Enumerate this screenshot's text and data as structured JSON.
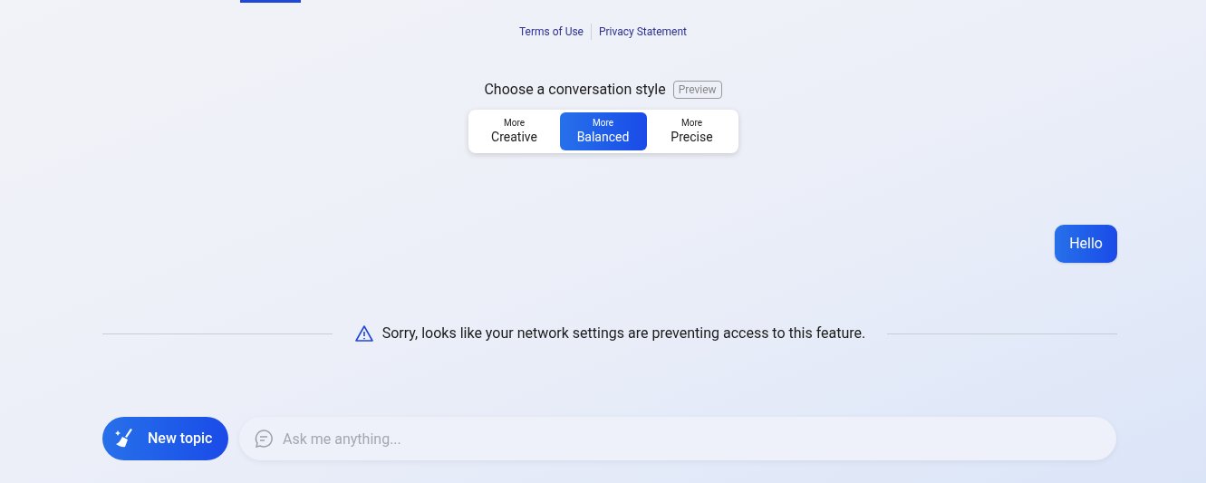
{
  "footer_links": [
    "Terms of Use",
    "Privacy Statement"
  ],
  "style_picker": {
    "title": "Choose a conversation style",
    "badge": "Preview",
    "options": [
      {
        "prefix": "More",
        "label": "Creative",
        "selected": false
      },
      {
        "prefix": "More",
        "label": "Balanced",
        "selected": true
      },
      {
        "prefix": "More",
        "label": "Precise",
        "selected": false
      }
    ]
  },
  "messages": [
    {
      "kind": "user",
      "text": "Hello"
    },
    {
      "kind": "notice",
      "text": "Sorry, looks like your network settings are preventing access to this feature."
    }
  ],
  "composer": {
    "new_topic": "New topic",
    "placeholder": "Ask me anything..."
  }
}
